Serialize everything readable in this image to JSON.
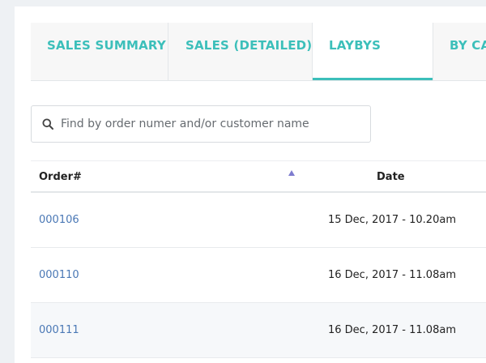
{
  "tabs": [
    {
      "label": "SALES SUMMARY"
    },
    {
      "label": "SALES (DETAILED)"
    },
    {
      "label": "LAYBYS"
    },
    {
      "label": "BY CA"
    }
  ],
  "active_tab": "LAYBYS",
  "search": {
    "placeholder": "Find by order numer and/or customer name",
    "value": ""
  },
  "table": {
    "headers": {
      "order": "Order#",
      "date": "Date"
    },
    "sort_column": "Order#",
    "sort_direction": "ascending",
    "rows": [
      {
        "order": "000106",
        "date": "15 Dec, 2017 - 10.20am"
      },
      {
        "order": "000110",
        "date": "16 Dec, 2017 - 11.08am"
      },
      {
        "order": "000111",
        "date": "16 Dec, 2017 - 11.08am"
      }
    ]
  },
  "colors": {
    "accent": "#3cbfba",
    "link": "#4a78b5",
    "sort_indicator": "#7e7ccf"
  }
}
